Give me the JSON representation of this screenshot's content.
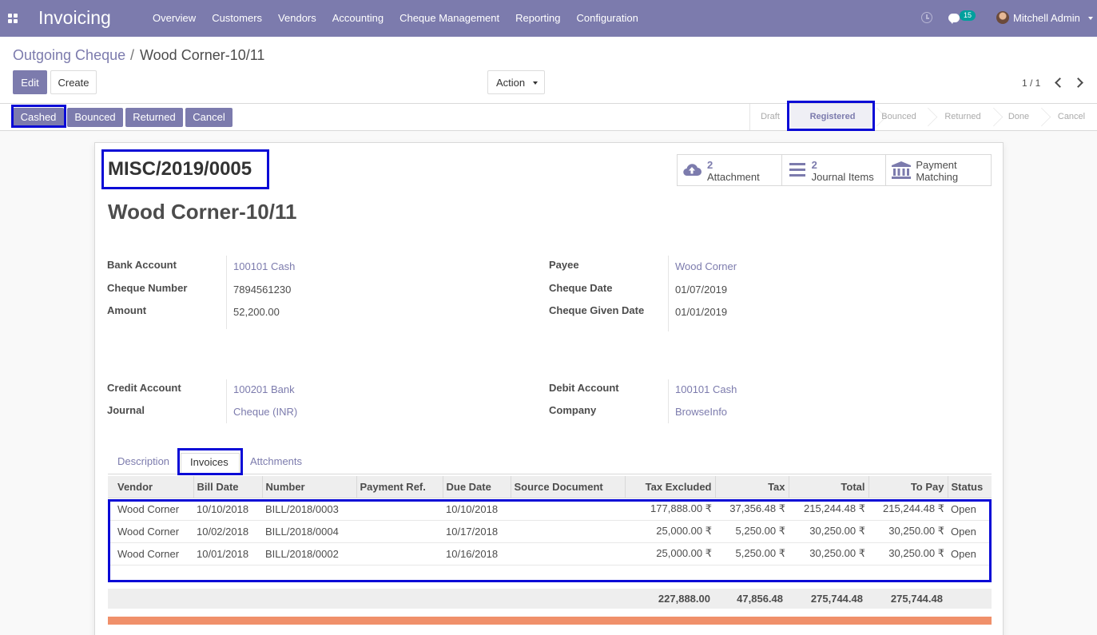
{
  "navbar": {
    "app_title": "Invoicing",
    "menu": [
      "Overview",
      "Customers",
      "Vendors",
      "Accounting",
      "Cheque Management",
      "Reporting",
      "Configuration"
    ],
    "chat_count": "15",
    "user_name": "Mitchell Admin",
    "bg_color": "#7c7bad"
  },
  "breadcrumb": {
    "parent": "Outgoing Cheque",
    "separator": "/",
    "current": "Wood Corner-10/11"
  },
  "toolbar": {
    "edit_label": "Edit",
    "create_label": "Create",
    "action_label": "Action",
    "pager": "1 / 1"
  },
  "statusbar": {
    "buttons": [
      "Cashed",
      "Bounced",
      "Returned",
      "Cancel"
    ],
    "stages": [
      "Draft",
      "Registered",
      "Bounced",
      "Returned",
      "Done",
      "Cancel"
    ],
    "active_stage": "Registered"
  },
  "record": {
    "name": "MISC/2019/0005",
    "title": "Wood Corner-10/11"
  },
  "smart_buttons": {
    "attachment_count": "2",
    "attachment_label": "Attachment",
    "journal_count": "2",
    "journal_label": "Journal Items",
    "payment_line1": "Payment",
    "payment_line2": "Matching"
  },
  "fields": {
    "bank_account_label": "Bank Account",
    "bank_account": "100101 Cash",
    "cheque_number_label": "Cheque Number",
    "cheque_number": "7894561230",
    "amount_label": "Amount",
    "amount": "52,200.00",
    "payee_label": "Payee",
    "payee": "Wood Corner",
    "cheque_date_label": "Cheque Date",
    "cheque_date": "01/07/2019",
    "cheque_given_date_label": "Cheque Given Date",
    "cheque_given_date": "01/01/2019",
    "credit_account_label": "Credit Account",
    "credit_account": "100201 Bank",
    "journal_label": "Journal",
    "journal": "Cheque (INR)",
    "debit_account_label": "Debit Account",
    "debit_account": "100101 Cash",
    "company_label": "Company",
    "company": "BrowseInfo"
  },
  "tabs": [
    "Description",
    "Invoices",
    "Attchments"
  ],
  "active_tab": "Invoices",
  "invoices": {
    "columns": [
      "Vendor",
      "Bill Date",
      "Number",
      "Payment Ref.",
      "Due Date",
      "Source Document",
      "Tax Excluded",
      "Tax",
      "Total",
      "To Pay",
      "Status"
    ],
    "rows": [
      [
        "Wood Corner",
        "10/10/2018",
        "BILL/2018/0003",
        "",
        "10/10/2018",
        "",
        "177,888.00 ₹",
        "37,356.48 ₹",
        "215,244.48 ₹",
        "215,244.48 ₹",
        "Open"
      ],
      [
        "Wood Corner",
        "10/02/2018",
        "BILL/2018/0004",
        "",
        "10/17/2018",
        "",
        "25,000.00 ₹",
        "5,250.00 ₹",
        "30,250.00 ₹",
        "30,250.00 ₹",
        "Open"
      ],
      [
        "Wood Corner",
        "10/01/2018",
        "BILL/2018/0002",
        "",
        "10/16/2018",
        "",
        "25,000.00 ₹",
        "5,250.00 ₹",
        "30,250.00 ₹",
        "30,250.00 ₹",
        "Open"
      ]
    ],
    "totals": {
      "tax_excluded": "227,888.00",
      "tax": "47,856.48",
      "total": "275,744.48",
      "to_pay": "275,744.48"
    }
  }
}
